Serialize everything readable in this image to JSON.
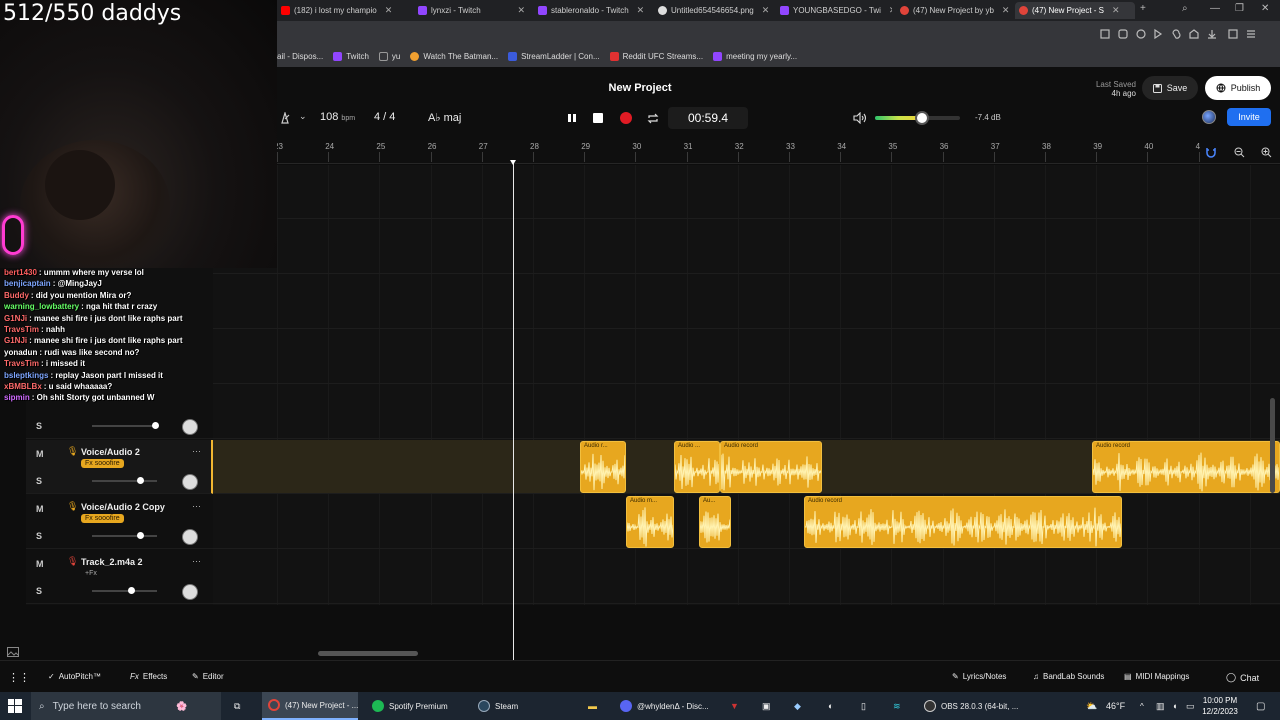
{
  "overlay": {
    "webcam_title": "512/550 daddys"
  },
  "browser": {
    "tabs": [
      {
        "title": "(182) i lost my champio",
        "color": "#ff0000"
      },
      {
        "title": "lynxzi - Twitch",
        "color": "#9146ff"
      },
      {
        "title": "stableronaldo - Twitch",
        "color": "#9146ff"
      },
      {
        "title": "Untitled654546654.png",
        "color": "#dddddd"
      },
      {
        "title": "YOUNGBASEDGO - Twi",
        "color": "#9146ff"
      },
      {
        "title": "(47) New Project by yb",
        "color": "#e0443a"
      },
      {
        "title": "(47) New Project - S",
        "color": "#e0443a"
      }
    ],
    "bookmarks": [
      {
        "title": "ail - Dispos...",
        "color": "#666666"
      },
      {
        "title": "Twitch",
        "color": "#9146ff"
      },
      {
        "title": "yu",
        "color": "#999999"
      },
      {
        "title": "Watch The Batman...",
        "color": "#f0a030"
      },
      {
        "title": "StreamLadder | Con...",
        "color": "#3b5bdb"
      },
      {
        "title": "Reddit UFC Streams...",
        "color": "#e03131"
      },
      {
        "title": "meeting my yearly...",
        "color": "#9146ff"
      }
    ]
  },
  "daw": {
    "project_title": "New Project",
    "last_saved_label": "Last Saved",
    "last_saved_value": "4h ago",
    "save_label": "Save",
    "publish_label": "Publish",
    "invite_label": "Invite",
    "tempo_value": "108",
    "tempo_unit": "bpm",
    "time_signature": "4 / 4",
    "key": "A♭ maj",
    "time": "00:59.4",
    "volume_level": 0.55,
    "volume_db": "-7.4 dB",
    "ruler_numbers": [
      "23",
      "24",
      "25",
      "26",
      "27",
      "28",
      "29",
      "30",
      "31",
      "32",
      "33",
      "34",
      "35",
      "36",
      "37",
      "38",
      "39",
      "40",
      "4"
    ],
    "tracks": [
      {
        "name": "Voice/Audio 2",
        "fx": "Fx sooofire",
        "mute": "M",
        "solo": "S",
        "volume": 0.75,
        "selected": true
      },
      {
        "name": "Voice/Audio 2 Copy",
        "fx": "Fx sooofire",
        "mute": "M",
        "solo": "S",
        "volume": 0.75,
        "selected": false
      },
      {
        "name": "Track_2.m4a 2",
        "fx": "+Fx",
        "mute": "M",
        "solo": "S",
        "volume": 0.6,
        "selected": false
      }
    ],
    "hidden_track_solo": "S",
    "clips": [
      {
        "label": "Audio r...",
        "lane": 5
      },
      {
        "label": "Audio ...",
        "lane": 5
      },
      {
        "label": "Audio record",
        "lane": 5
      },
      {
        "label": "Audio record",
        "lane": 5
      },
      {
        "label": "Audio m...",
        "lane": 6
      },
      {
        "label": "Au...",
        "lane": 6
      },
      {
        "label": "Audio record",
        "lane": 6
      }
    ],
    "bottom": {
      "autopitch": "AutoPitch™",
      "effects": "Effects",
      "editor": "Editor",
      "lyrics": "Lyrics/Notes",
      "sounds": "BandLab Sounds",
      "midi": "MIDI Mappings",
      "chat": "Chat"
    }
  },
  "chat": [
    {
      "user": "bert1430",
      "color": "#ff5f5f",
      "msg": ": ummm where my verse lol"
    },
    {
      "user": "benjicaptain",
      "color": "#7ea6ff",
      "msg": ": @MingJayJ"
    },
    {
      "user": "Buddy",
      "color": "#ff6b6b",
      "msg": ": did you mention Mira or?"
    },
    {
      "user": "warning_lowbattery",
      "color": "#66ff66",
      "msg": ": nga hit that r crazy"
    },
    {
      "user": "G1NJi",
      "color": "#ff6b6b",
      "msg": ": manee shi fire i jus dont like raphs part"
    },
    {
      "user": "TravsTim",
      "color": "#ff6b6b",
      "msg": ": nahh"
    },
    {
      "user": "G1NJi",
      "color": "#ff6b6b",
      "msg": ": manee shi fire i jus dont like raphs part"
    },
    {
      "user": "yonadun",
      "color": "#ffffff",
      "msg": ": rudi was like second no?"
    },
    {
      "user": "TravsTim",
      "color": "#ff6b6b",
      "msg": ": i missed it"
    },
    {
      "user": "bsleptkings",
      "color": "#7ea6ff",
      "msg": ": replay Jason part I missed it"
    },
    {
      "user": "xBMBLBx",
      "color": "#ff6b6b",
      "msg": ": u said whaaaaa?"
    },
    {
      "user": "sipmin",
      "color": "#d06bff",
      "msg": ": Oh shit Storty got unbanned W"
    }
  ],
  "taskbar": {
    "search_placeholder": "Type here to search",
    "apps": [
      {
        "title": "(47) New Project - ...",
        "color": "#e0443a"
      },
      {
        "title": "Spotify Premium",
        "color": "#1db954"
      },
      {
        "title": "Steam",
        "color": "#2a475e"
      },
      {
        "title": "@whyldenΔ - Disc...",
        "color": "#5865f2"
      },
      {
        "title": "OBS 28.0.3 (64-bit, ...",
        "color": "#333333"
      }
    ],
    "weather": "46°F",
    "time": "10:00 PM",
    "date": "12/2/2023"
  }
}
